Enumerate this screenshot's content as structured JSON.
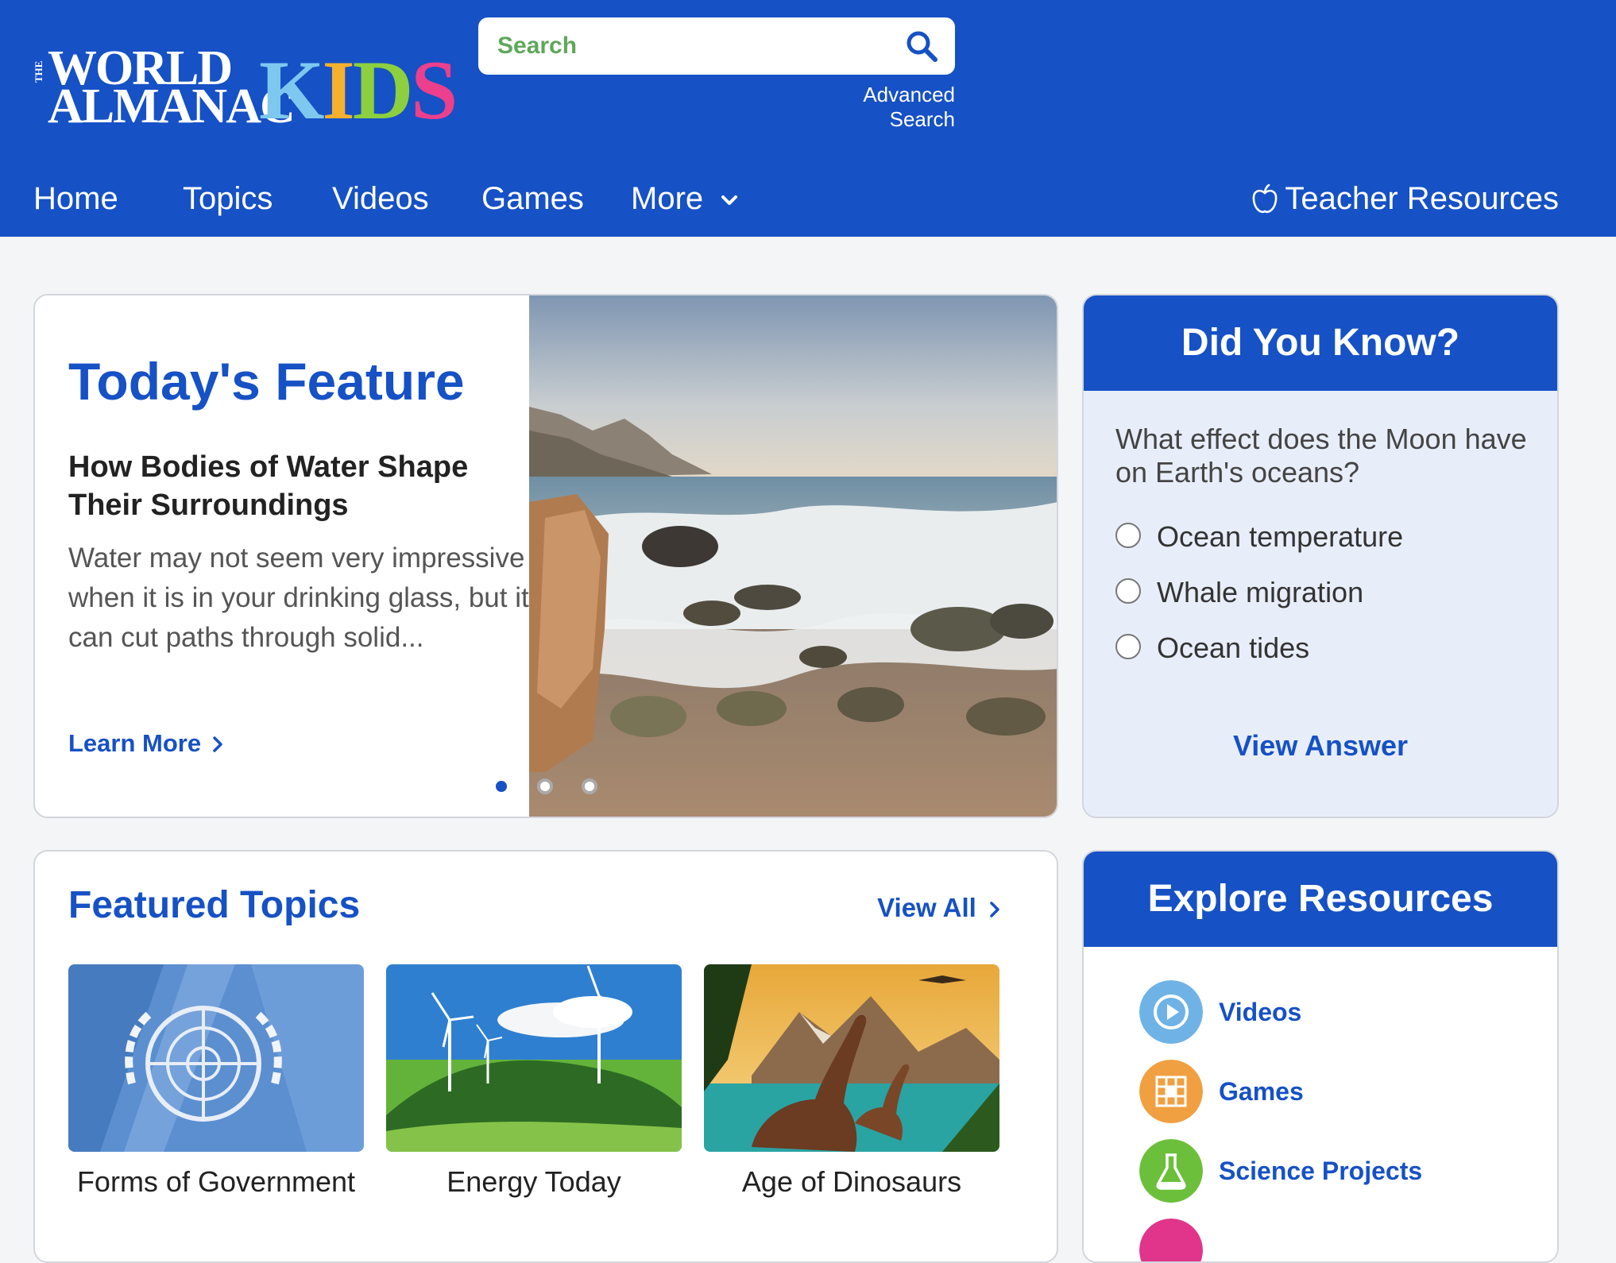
{
  "header": {
    "logo_the": "THE",
    "logo_world": "WORLD",
    "logo_almanac": "ALMANAC",
    "logo_kids": [
      "K",
      "I",
      "D",
      "S"
    ],
    "logo_kids_colors": [
      "#7ec8f0",
      "#f5b02e",
      "#8ccf3f",
      "#ec3f8c"
    ],
    "search_placeholder": "Search",
    "advanced_search": "Advanced Search",
    "brand_color": "#1651c5"
  },
  "nav": {
    "items": [
      "Home",
      "Topics",
      "Videos",
      "Games",
      "More"
    ],
    "teacher_resources": "Teacher Resources"
  },
  "feature": {
    "title": "Today's Feature",
    "headline": "How Bodies of Water Shape Their Surroundings",
    "description": "Water may not seem very impressive when it is in your drinking glass, but it can cut paths through solid...",
    "link": "Learn More",
    "image": "coastal-beach-waves",
    "slides_total": 3,
    "slide_active": 1
  },
  "did_you_know": {
    "title": "Did You Know?",
    "question": "What effect does the Moon have on Earth's oceans?",
    "options": [
      "Ocean temperature",
      "Whale migration",
      "Ocean tides"
    ],
    "action": "View Answer"
  },
  "featured_topics": {
    "title": "Featured Topics",
    "view_all": "View All",
    "items": [
      {
        "label": "Forms of Government",
        "image": "un-flag"
      },
      {
        "label": "Energy Today",
        "image": "wind-turbines"
      },
      {
        "label": "Age of Dinosaurs",
        "image": "dinosaurs"
      }
    ]
  },
  "explore_resources": {
    "title": "Explore Resources",
    "items": [
      {
        "label": "Videos",
        "icon": "play-icon",
        "color": "#6fb3e6"
      },
      {
        "label": "Games",
        "icon": "puzzle-grid-icon",
        "color": "#f0a041"
      },
      {
        "label": "Science Projects",
        "icon": "flask-icon",
        "color": "#6cbf3a"
      },
      {
        "label": "",
        "icon": "more-icon",
        "color": "#e0358a"
      }
    ]
  }
}
